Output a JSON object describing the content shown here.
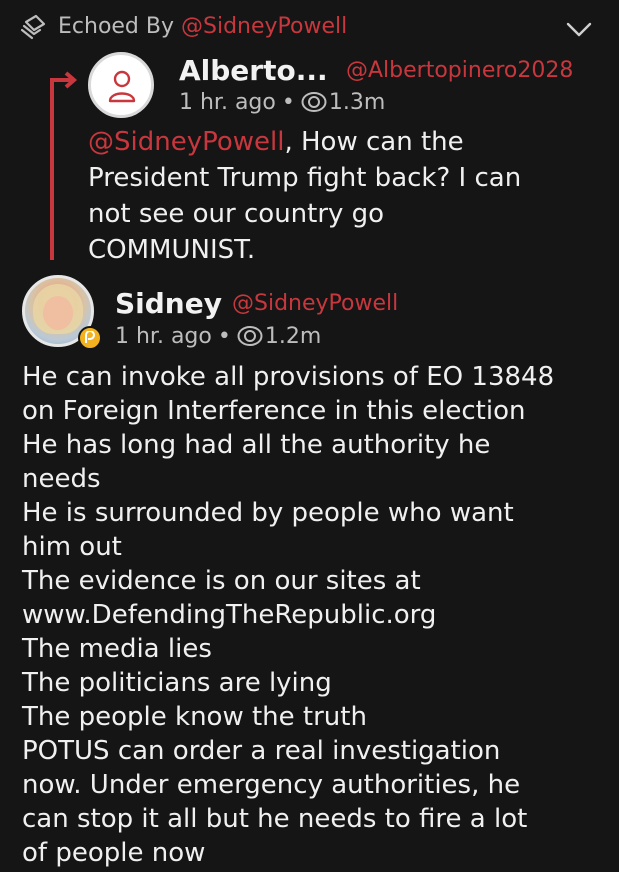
{
  "echo": {
    "prefix": "Echoed By",
    "handle": "@SidneyPowell"
  },
  "reply_to": {
    "name": "Alberto...",
    "handle": "@Albertopinero2028",
    "time": "1 hr. ago",
    "views": "1.3m",
    "mention": "@SidneyPowell",
    "text_lines": [
      ", How can the",
      "President Trump fight back? I can",
      "not see our country go",
      "COMMUNIST."
    ]
  },
  "post": {
    "name": "Sidney",
    "handle": "@SidneyPowell",
    "time": "1 hr. ago",
    "views": "1.2m",
    "lines": [
      "He can invoke all provisions of EO 13848",
      "on Foreign Interference in this election",
      "He has long had all the authority he",
      "needs",
      "He is surrounded by people who want",
      "him out",
      "The evidence is on our sites at",
      "www.DefendingTheRepublic.org",
      "The media lies",
      "The politicians are lying",
      "The people know the truth",
      "POTUS can order a real investigation",
      "now. Under emergency authorities, he",
      "can stop it all but he needs to fire a lot",
      "of people now"
    ]
  },
  "colors": {
    "accent": "#c8373d",
    "background": "#151515",
    "badge": "#f3b321"
  },
  "icons": {
    "echo": "echo-icon",
    "collapse": "chevron-down-icon",
    "views": "eye-icon",
    "badge": "parler-badge-icon",
    "default_avatar": "user-icon"
  }
}
